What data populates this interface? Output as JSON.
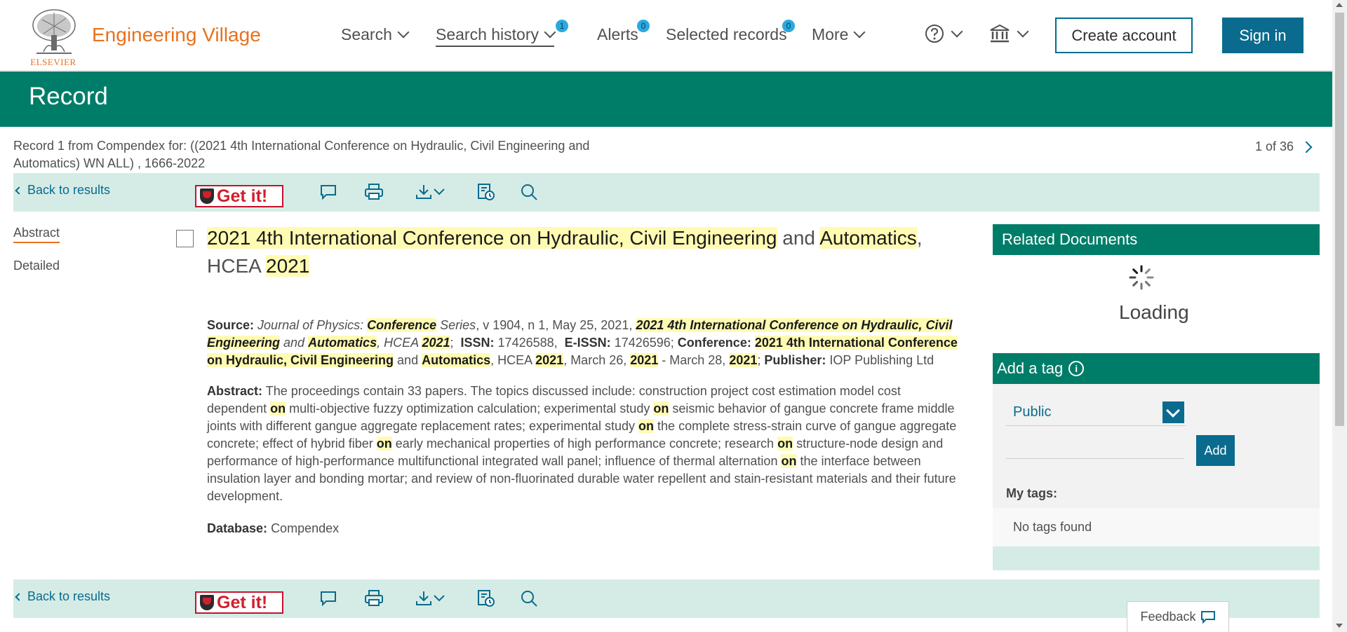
{
  "header": {
    "logo_text": "ELSEVIER",
    "brand": "Engineering Village",
    "nav": {
      "search": "Search",
      "search_history": "Search history",
      "search_history_count": "1",
      "alerts": "Alerts",
      "alerts_count": "0",
      "selected_records": "Selected records",
      "selected_records_count": "0",
      "more": "More"
    },
    "create_account": "Create account",
    "sign_in": "Sign in"
  },
  "banner": {
    "title": "Record"
  },
  "record_info": {
    "text": "Record 1 from Compendex for: ((2021 4th International Conference on Hydraulic, Civil Engineering and Automatics) WN ALL) , 1666-2022",
    "pager": "1 of 36"
  },
  "toolbar": {
    "back": "Back to results",
    "getit": "Get it!"
  },
  "left_nav": {
    "abstract": "Abstract",
    "detailed": "Detailed"
  },
  "record": {
    "title_parts": [
      "2021 4th International Conference on Hydraulic, Civil Engineering",
      " and ",
      "Automatics",
      ", HCEA ",
      "2021"
    ],
    "source": {
      "label": "Source:",
      "journal_a": "Journal of Physics: ",
      "journal_hl": "Conference",
      "journal_b": " Series",
      "rest_a": ", v 1904, n 1, May 25, 2021, ",
      "conf_hl": "2021 4th International Conference on Hydraulic, Civil Engineering",
      "and1": " and ",
      "auto_hl": "Automatics",
      "hcea": ", HCEA ",
      "year_hl": "2021",
      "semi": ";",
      "issn_label": "ISSN:",
      "issn": "17426588,",
      "eissn_label": "E-ISSN:",
      "eissn": "17426596;",
      "conf_label": "Conference:",
      "conf2_hl": "2021 4th International Conference on Hydraulic, Civil Engineering",
      "and2": " and ",
      "auto2_hl": "Automatics",
      "hcea2": ", HCEA ",
      "year2_hl": "2021",
      "date_a": ", March 26, ",
      "year3_hl": "2021",
      "date_b": " - March 28, ",
      "year4_hl": "2021",
      "semi2": ";",
      "publisher_label": "Publisher:",
      "publisher": "IOP Publishing Ltd"
    },
    "abstract": {
      "label": "Abstract:",
      "p1": "The proceedings contain 33 papers. The topics discussed include: construction project cost estimation model cost dependent ",
      "on": "on",
      "p2": " multi-objective fuzzy optimization calculation; experimental study ",
      "p3": " seismic behavior of gangue concrete frame middle joints with different gangue aggregate replacement rates; experimental study ",
      "p4": " the complete stress-strain curve of gangue aggregate concrete; effect of hybrid fiber ",
      "p5": " early mechanical properties of high performance concrete; research ",
      "p6": " structure-node design and performance of high-performance multifunctional integrated wall panel; influence of thermal alternation ",
      "p7": " the interface between insulation layer and bonding mortar; and review of non-fluorinated durable water repellent and stain-resistant materials and their future development."
    },
    "database": {
      "label": "Database:",
      "value": "Compendex"
    }
  },
  "related": {
    "title": "Related Documents",
    "loading": "Loading"
  },
  "tags": {
    "title": "Add a tag",
    "visibility": "Public",
    "add": "Add",
    "my_tags": "My tags:",
    "none": "No tags found"
  },
  "feedback": "Feedback",
  "colors": {
    "brand_orange": "#e9711c",
    "primary_green": "#007d68",
    "primary_blue": "#0a6b8e",
    "toolbar_bg": "#d5ece6",
    "highlight": "#fffbb3"
  }
}
